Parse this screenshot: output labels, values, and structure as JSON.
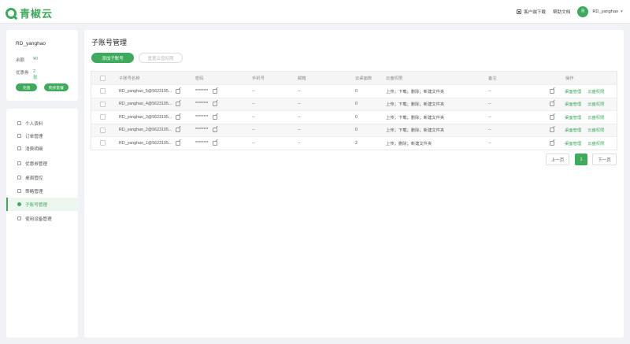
{
  "app": {
    "logo_text": "青椒云",
    "client_download": "客户端下载",
    "help_docs": "帮助文档",
    "avatar_letter": "R",
    "username": "RD_yanghao",
    "accent_color": "#3daa5c"
  },
  "user_card": {
    "name": "RD_yanghao",
    "balance_label": "余额",
    "balance_value": "¥0",
    "coupon_label": "优惠券",
    "coupon_value": "2张",
    "recharge_button": "充值",
    "buy_package_button": "购买套餐"
  },
  "sidebar": {
    "items": [
      {
        "label": "个人资料",
        "icon": "user-icon"
      },
      {
        "label": "订单管理",
        "icon": "order-icon"
      },
      {
        "label": "消费明细",
        "icon": "list-icon"
      },
      {
        "label": "优惠券管理",
        "icon": "coupon-icon"
      },
      {
        "label": "桌面管控",
        "icon": "desktop-icon"
      },
      {
        "label": "策略管理",
        "icon": "strategy-icon"
      },
      {
        "label": "子账号管理",
        "icon": "subaccount-icon",
        "active": true
      },
      {
        "label": "使用设备管理",
        "icon": "device-icon"
      }
    ]
  },
  "main": {
    "title": "子账号管理",
    "add_button": "添加子账号",
    "reset_button": "重置云盘权限",
    "columns": [
      "子账号名称",
      "密码",
      "手机号",
      "邮箱",
      "云桌面数",
      "云盘权限",
      "备注",
      "操作"
    ],
    "rows": [
      {
        "name": "RD_yanghao_5@5623105...",
        "password": "********",
        "phone": "--",
        "email": "--",
        "desktops": "0",
        "permission": "上传；下载；删除；新建文件夹",
        "note": "--",
        "op1": "桌面管理",
        "op2": "云盘权限"
      },
      {
        "name": "RD_yanghao_4@5623105...",
        "password": "********",
        "phone": "--",
        "email": "--",
        "desktops": "0",
        "permission": "上传；下载；删除；新建文件夹",
        "note": "--",
        "op1": "桌面管理",
        "op2": "云盘权限"
      },
      {
        "name": "RD_yanghao_3@5623105...",
        "password": "********",
        "phone": "--",
        "email": "--",
        "desktops": "0",
        "permission": "上传；下载；删除；新建文件夹",
        "note": "--",
        "op1": "桌面管理",
        "op2": "云盘权限"
      },
      {
        "name": "RD_yanghao_2@5623105...",
        "password": "********",
        "phone": "--",
        "email": "--",
        "desktops": "0",
        "permission": "上传；下载；删除；新建文件夹",
        "note": "--",
        "op1": "桌面管理",
        "op2": "云盘权限"
      },
      {
        "name": "RD_yanghao_1@5623105...",
        "password": "********",
        "phone": "--",
        "email": "--",
        "desktops": "2",
        "permission": "上传；删除；新建文件夹",
        "note": "--",
        "op1": "桌面管理",
        "op2": "云盘权限"
      }
    ],
    "pager": {
      "prev": "上一页",
      "current": "1",
      "next": "下一页"
    }
  }
}
